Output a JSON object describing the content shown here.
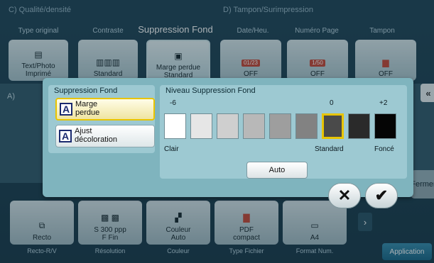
{
  "sections": {
    "quality": "C)  Qualité/densité",
    "stamp": "D)  Tampon/Surimpression",
    "a": "A)"
  },
  "top_tabs": [
    "Type original",
    "Contraste",
    "Suppression Fond",
    "Date/Heu.",
    "Numéro Page",
    "Tampon"
  ],
  "top_tiles": [
    {
      "label": "Text/Photo\nImprimé",
      "icon": "document-icon"
    },
    {
      "label": "Standard",
      "icon": "contrast-icon"
    },
    {
      "label": "Marge perdue\nStandard",
      "icon": "suppression-icon"
    },
    {
      "label": "OFF",
      "icon": "date-icon",
      "badge": "01/23"
    },
    {
      "label": "OFF",
      "icon": "page-number-icon",
      "badge": "1/50"
    },
    {
      "label": "OFF",
      "icon": "stamp-icon"
    }
  ],
  "dialog": {
    "left_title": "Suppression Fond",
    "options": [
      {
        "label": "Marge\nperdue",
        "selected": true
      },
      {
        "label": "Ajust\ndécoloration",
        "selected": false
      }
    ],
    "right_title": "Niveau Suppression Fond",
    "level_labels": {
      "min": "-6",
      "zero": "0",
      "max": "+2"
    },
    "scale": {
      "left": "Clair",
      "middle": "Standard",
      "right": "Foncé"
    },
    "swatches": [
      "#ffffff",
      "#e6e6e6",
      "#cfcfcf",
      "#b8b8b8",
      "#9e9e9e",
      "#828282",
      "#4a4a4a",
      "#2a2a2a",
      "#050505"
    ],
    "selected_index": 6,
    "auto_label": "Auto",
    "cancel_symbol": "✕",
    "ok_symbol": "✔"
  },
  "fermer": "Fermer",
  "bottom_tiles": [
    {
      "label": "Recto",
      "sub": "Recto-R/V"
    },
    {
      "label": "S 300 ppp\nF Fin",
      "sub": "Résolution"
    },
    {
      "label": "Couleur\nAuto",
      "sub": "Couleur"
    },
    {
      "label": "PDF\ncompact",
      "sub": "Type Fichier"
    },
    {
      "label": "A4",
      "sub": "Format Num."
    }
  ],
  "next_arrow": "›",
  "side_arrow": "«",
  "application": "Application"
}
